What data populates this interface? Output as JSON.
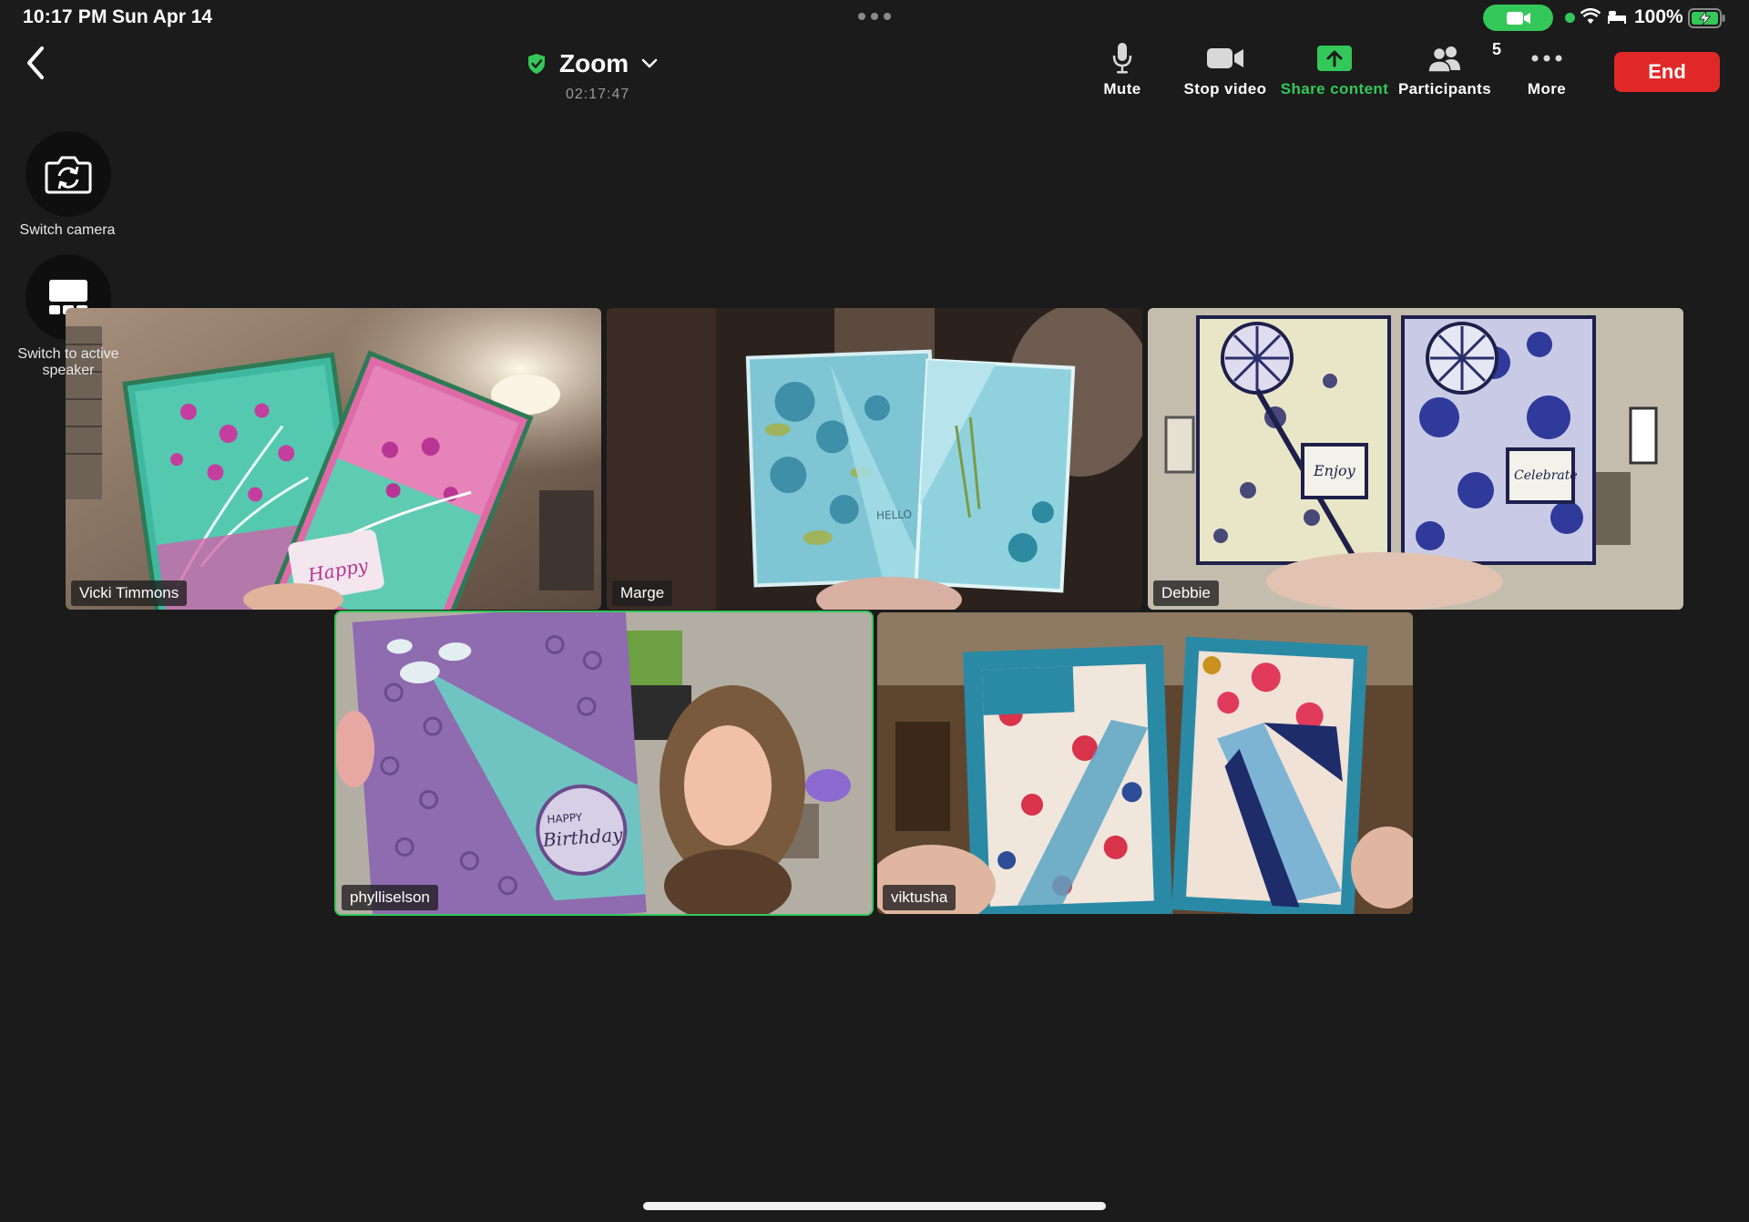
{
  "status_bar": {
    "time": "10:17 PM",
    "date": "Sun Apr 14",
    "battery": "100%",
    "icons": [
      "camera-in-use-icon",
      "wifi-icon",
      "sleep-bed-icon",
      "battery-charging-icon"
    ]
  },
  "meeting": {
    "title": "Zoom",
    "timer": "02:17:47",
    "secure_icon": "shield-check-icon"
  },
  "toolbar": {
    "mute": "Mute",
    "stop_video": "Stop video",
    "share_content": "Share content",
    "participants": "Participants",
    "participant_count": "5",
    "more": "More",
    "end": "End"
  },
  "side_controls": {
    "switch_camera": "Switch camera",
    "switch_speaker": "Switch to active speaker"
  },
  "participants": [
    {
      "name": "Vicki Timmons",
      "active": false
    },
    {
      "name": "Marge",
      "active": false
    },
    {
      "name": "Debbie",
      "active": false
    },
    {
      "name": "phylliselson",
      "active": true
    },
    {
      "name": "viktusha",
      "active": false
    }
  ],
  "colors": {
    "background": "#1b1b1b",
    "accent_green": "#34c759",
    "end_red": "#e02828"
  }
}
